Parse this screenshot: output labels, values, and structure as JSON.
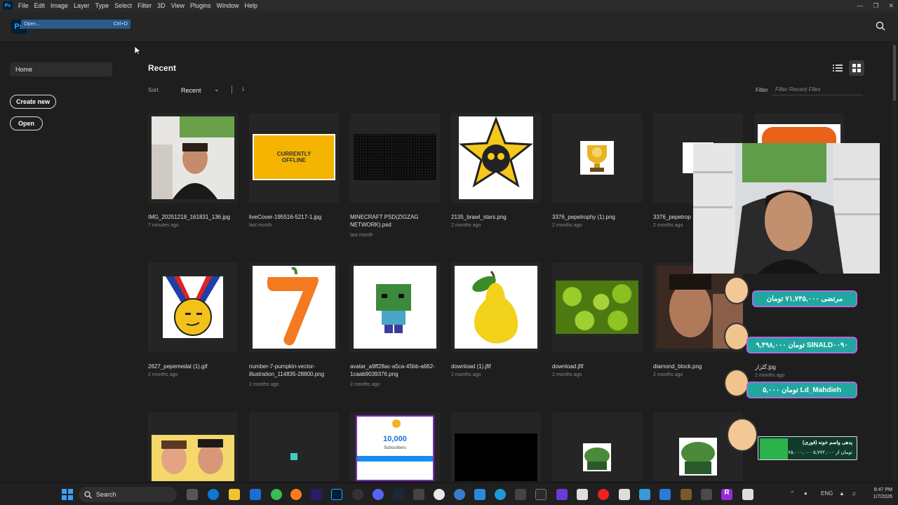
{
  "menu": [
    "File",
    "Edit",
    "Image",
    "Layer",
    "Type",
    "Select",
    "Filter",
    "3D",
    "View",
    "Plugins",
    "Window",
    "Help"
  ],
  "app_logo": "Ps",
  "open_hint": {
    "label": "Open...",
    "shortcut": "Ctrl+O"
  },
  "sidebar": {
    "home": "Home",
    "create_new": "Create new",
    "open": "Open"
  },
  "recent": {
    "title": "Recent",
    "sort_label": "Sort",
    "sort_value": "Recent",
    "filter_label": "Filter",
    "filter_placeholder": "Filter Recent Files"
  },
  "files": [
    {
      "name": "IMG_20251218_161831_136.jpg",
      "date": "7 minutes ago"
    },
    {
      "name": "liveCover-195516-5217-1.jpg",
      "date": "last month"
    },
    {
      "name": "MINECRAFT PSD(ZIGZAG NETWORK).psd",
      "date": "last month"
    },
    {
      "name": "2135_brawl_stars.png",
      "date": "2 months ago"
    },
    {
      "name": "3376_pepetrophy (1).png",
      "date": "2 months ago"
    },
    {
      "name": "3376_pepetrop",
      "date": "2 months ago"
    },
    {
      "name": "",
      "date": ""
    },
    {
      "name": "2627_pepemedal (1).gif",
      "date": "2 months ago"
    },
    {
      "name": "number-7-pumpkin-vector-illustration_114835-28800.png",
      "date": "2 months ago"
    },
    {
      "name": "avatar_a9ff28ac-a5ca-45bb-a662-1caab9039376.png",
      "date": "2 months ago"
    },
    {
      "name": "download (1).jfif",
      "date": "2 months ago"
    },
    {
      "name": "download.jfif",
      "date": "2 months ago"
    },
    {
      "name": "diamond_block.png",
      "date": "2 months ago"
    }
  ],
  "thumb_texts": {
    "live_cover": "CURRENTLY OFFLINE",
    "subs_count": "10,000",
    "subs_label": "Subscribers"
  },
  "overlay": {
    "extra_file": {
      "name": "گلزار.jpg",
      "date": "2 months ago"
    },
    "donations": [
      {
        "text": "مرتضی ۷۱,۷۴۵,۰۰۰ تومان"
      },
      {
        "text": "۹,۴۹۸,۰۰۰ تومان SINALD۰۰۹۰"
      },
      {
        "text": "۵,۰۰۰ تومان Ld_Mahdieh"
      }
    ],
    "goal": {
      "title": "پدهی واسم خونه (فوری)",
      "amount": "۶۵,۰۰۰,۰۰۰ تومان از ۵,۷۷۲,۰۰۰"
    }
  },
  "taskbar": {
    "search": "Search",
    "lang": "ENG",
    "time": "8:47 PM",
    "date": "1/7/2026"
  },
  "colors": {
    "ps_blue": "#31a8ff",
    "ps_dark": "#001e36",
    "bg": "#1e1e1e",
    "donation": "#1fa7a0",
    "donation_border": "#b06adf"
  }
}
